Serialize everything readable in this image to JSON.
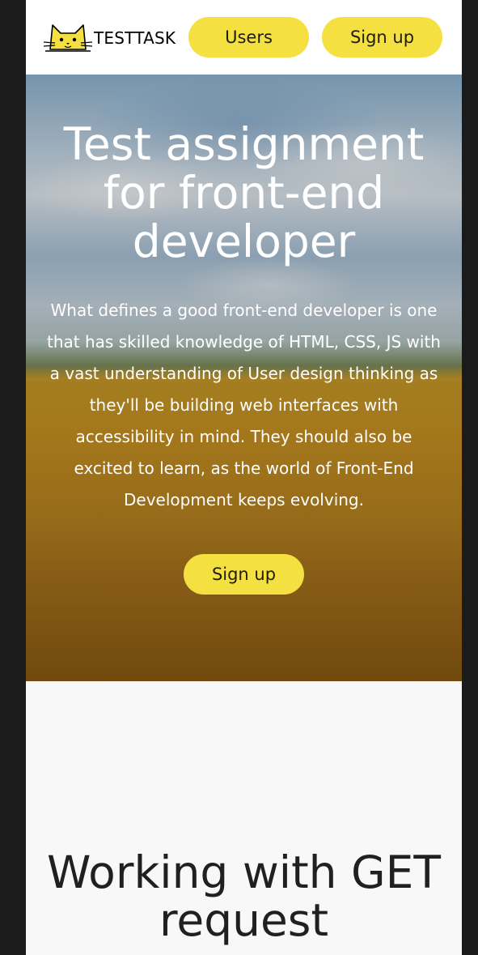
{
  "header": {
    "logo_text": "TESTTASK",
    "nav": {
      "users_label": "Users",
      "signup_label": "Sign up"
    }
  },
  "hero": {
    "title": "Test assignment for front-end developer",
    "text": "What defines a good front-end developer is one that has skilled knowledge of HTML, CSS, JS with a vast understanding of User design thinking as they'll be building web interfaces with accessibility in mind. They should also be excited to learn, as the world of Front-End Development keeps evolving.",
    "button_label": "Sign up"
  },
  "get_section": {
    "title": "Working with GET request"
  },
  "colors": {
    "accent": "#f4e041",
    "page_background": "#f8f8f8",
    "outer_background": "#1b1b1b"
  }
}
